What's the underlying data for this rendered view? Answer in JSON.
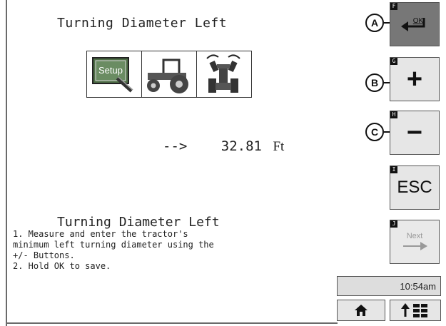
{
  "screen": {
    "title": "Turning Diameter Left",
    "icons": {
      "setup_label": "Setup"
    },
    "value": {
      "arrow": "-->",
      "number": "32.81",
      "unit": "Ft"
    },
    "instructions": {
      "title": "Turning Diameter Left",
      "text": "1. Measure and enter the tractor's\nminimum left turning diameter using the\n+/- Buttons.\n2. Hold OK to save."
    }
  },
  "side_buttons": {
    "ok": {
      "tag": "F",
      "label": "OK",
      "callout": "A"
    },
    "plus": {
      "tag": "G",
      "label": "+",
      "callout": "B"
    },
    "minus": {
      "tag": "H",
      "label": "−",
      "callout": "C"
    },
    "esc": {
      "tag": "I",
      "label": "ESC"
    },
    "next": {
      "tag": "J",
      "label": "Next"
    }
  },
  "status": {
    "clock": "10:54am"
  },
  "colors": {
    "ok_button_bg": "#777777",
    "button_bg": "#e6e6e6",
    "setup_green": "#4f6f47"
  }
}
